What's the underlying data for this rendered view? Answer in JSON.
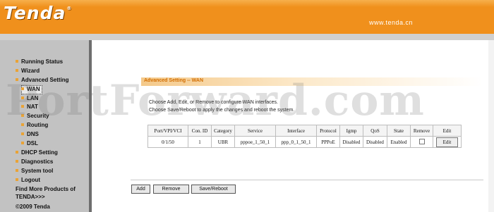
{
  "header": {
    "logo": "Tenda",
    "logo_mark": "®",
    "site_url": "www.tenda.cn"
  },
  "sidebar": {
    "items": [
      {
        "label": "Running Status",
        "level": 0
      },
      {
        "label": "Wizard",
        "level": 0
      },
      {
        "label": "Advanced Setting",
        "level": 0
      },
      {
        "label": "WAN",
        "level": 1,
        "selected": true
      },
      {
        "label": "LAN",
        "level": 1
      },
      {
        "label": "NAT",
        "level": 1
      },
      {
        "label": "Security",
        "level": 1
      },
      {
        "label": "Routing",
        "level": 1
      },
      {
        "label": "DNS",
        "level": 1
      },
      {
        "label": "DSL",
        "level": 1
      },
      {
        "label": "DHCP Setting",
        "level": 0
      },
      {
        "label": "Diagnostics",
        "level": 0
      },
      {
        "label": "System tool",
        "level": 0
      },
      {
        "label": "Logout",
        "level": 0
      }
    ],
    "more_products_line1": "Find More Products of",
    "more_products_line2": "TENDA>>>",
    "copyright": "©2009 Tenda"
  },
  "main": {
    "section_title": "Advanced Setting -- WAN",
    "description_line1": "Choose Add, Edit, or Remove to configure WAN interfaces.",
    "description_line2": "Choose Save/Reboot to apply the changes and reboot the system.",
    "table": {
      "columns": [
        "Port/VPI/VCI",
        "Con. ID",
        "Category",
        "Service",
        "Interface",
        "Protocol",
        "Igmp",
        "QoS",
        "State",
        "Remove",
        "Edit"
      ],
      "rows": [
        [
          "0/1/50",
          "1",
          "UBR",
          "pppoe_1_50_1",
          "ppp_0_1_50_1",
          "PPPoE",
          "Disabled",
          "Disabled",
          "Enabled",
          "",
          "Edit"
        ]
      ]
    },
    "buttons": {
      "add": "Add",
      "remove": "Remove",
      "save_reboot": "Save/Reboot"
    }
  },
  "watermark": "PortForward.com",
  "colors": {
    "header_orange": "#f0901c",
    "section_orange": "#d26d00",
    "sidebar_gray": "#c2c2c2"
  }
}
